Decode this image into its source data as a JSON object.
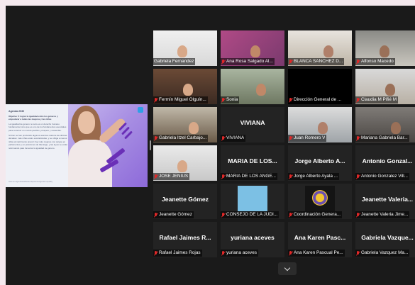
{
  "shared_content": {
    "heading": "Agenda 2030",
    "subheading": "Objetivo 5: lograr la igualdad entre los géneros y empoderar a todas las mujeres y las niñas",
    "paragraphs": [
      "La igualdad de género no solo es un derecho humano fundamental, sino que es uno de los fundamentos esenciales para construir un mundo pacífico, próspero y sostenible.",
      "Si bien se han producido algunos avances durante las últimas décadas: más niñas están escolarizadas, y se obliga a menos niñas al matrimonio precoz; hay más mujeres con cargos en parlamentos y en posiciones de liderazgo, y las leyes se están reformando para fomentar la igualdad de género."
    ],
    "footer": "www.un.org/sustainabledevelopment/es/gender-equality"
  },
  "participants": [
    {
      "caption": "Gabriela Fernandez",
      "muted": false,
      "active": true,
      "type": "video"
    },
    {
      "caption": "Ana Rosa Salgado Al...",
      "muted": true,
      "type": "video"
    },
    {
      "caption": "BLANCA SANCHEZ D...",
      "muted": true,
      "type": "video"
    },
    {
      "caption": "Alfonso Macedo",
      "muted": true,
      "type": "video"
    },
    {
      "caption": "Fermín Miguel Olguín...",
      "muted": true,
      "type": "video"
    },
    {
      "caption": "Sonia",
      "muted": true,
      "type": "video"
    },
    {
      "caption": "Dirección General de ...",
      "muted": true,
      "type": "blank"
    },
    {
      "caption": "Claudia M Pifié M",
      "muted": true,
      "type": "video"
    },
    {
      "caption": "Gabriela Itzel Carbajo...",
      "muted": true,
      "type": "video"
    },
    {
      "caption": "VIVIANA",
      "name": "VIVIANA",
      "muted": true,
      "type": "name"
    },
    {
      "caption": "Juan Romero V",
      "muted": true,
      "type": "video"
    },
    {
      "caption": "Mariana Gabriela Bar...",
      "muted": true,
      "type": "video"
    },
    {
      "caption": "JOSE JENIUS",
      "muted": true,
      "type": "video"
    },
    {
      "caption": "MARIA DE LOS ANGE...",
      "name": "MARIA DE LOS...",
      "muted": true,
      "type": "name"
    },
    {
      "caption": "Jorge Alberto Ayala ...",
      "name": "Jorge Alberto A...",
      "muted": true,
      "type": "name"
    },
    {
      "caption": "Antonio Gonzalez Vill...",
      "name": "Antonio Gonzal...",
      "muted": true,
      "type": "name"
    },
    {
      "caption": "Jeanette Gómez",
      "name": "Jeanette Gómez",
      "muted": true,
      "type": "name"
    },
    {
      "caption": "CONSEJO DE LA JUDI...",
      "muted": true,
      "type": "avatar-blue"
    },
    {
      "caption": "Coordinación Genera...",
      "muted": true,
      "type": "avatar-logo"
    },
    {
      "caption": "Jeanette Valeria Jime...",
      "name": "Jeanette Valeria...",
      "muted": true,
      "type": "name"
    },
    {
      "caption": "Rafael Jaimes Rojas",
      "name": "Rafael Jaimes R...",
      "muted": true,
      "type": "name"
    },
    {
      "caption": "yuriana aceves",
      "name": "yuriana aceves",
      "muted": true,
      "type": "name"
    },
    {
      "caption": "Ana Karen Pascual Pe...",
      "name": "Ana Karen Pasc...",
      "muted": true,
      "type": "name"
    },
    {
      "caption": "Gabriela Vazquez Ma...",
      "name": "Gabriela Vazque...",
      "muted": true,
      "type": "name"
    }
  ],
  "controls": {
    "expand_icon": "chevron-down-icon"
  },
  "colors": {
    "active_border": "#e6e600",
    "mic_muted": "#e02828"
  }
}
